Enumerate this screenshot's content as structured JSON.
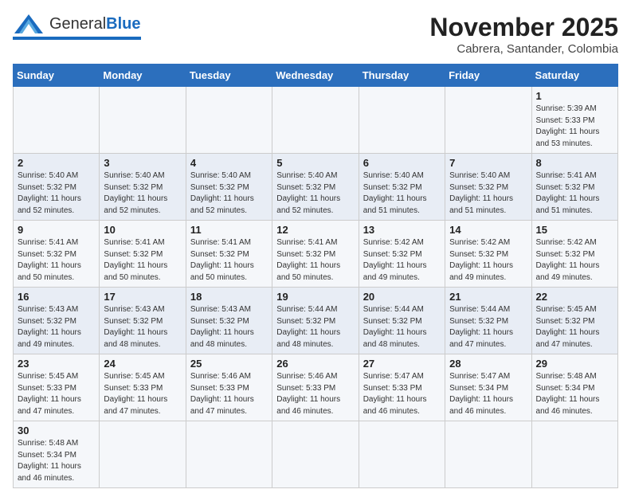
{
  "logo": {
    "text_general": "General",
    "text_blue": "Blue"
  },
  "header": {
    "month_year": "November 2025",
    "location": "Cabrera, Santander, Colombia"
  },
  "weekdays": [
    "Sunday",
    "Monday",
    "Tuesday",
    "Wednesday",
    "Thursday",
    "Friday",
    "Saturday"
  ],
  "weeks": [
    [
      {
        "day": "",
        "info": ""
      },
      {
        "day": "",
        "info": ""
      },
      {
        "day": "",
        "info": ""
      },
      {
        "day": "",
        "info": ""
      },
      {
        "day": "",
        "info": ""
      },
      {
        "day": "",
        "info": ""
      },
      {
        "day": "1",
        "info": "Sunrise: 5:39 AM\nSunset: 5:33 PM\nDaylight: 11 hours\nand 53 minutes."
      }
    ],
    [
      {
        "day": "2",
        "info": "Sunrise: 5:40 AM\nSunset: 5:32 PM\nDaylight: 11 hours\nand 52 minutes."
      },
      {
        "day": "3",
        "info": "Sunrise: 5:40 AM\nSunset: 5:32 PM\nDaylight: 11 hours\nand 52 minutes."
      },
      {
        "day": "4",
        "info": "Sunrise: 5:40 AM\nSunset: 5:32 PM\nDaylight: 11 hours\nand 52 minutes."
      },
      {
        "day": "5",
        "info": "Sunrise: 5:40 AM\nSunset: 5:32 PM\nDaylight: 11 hours\nand 52 minutes."
      },
      {
        "day": "6",
        "info": "Sunrise: 5:40 AM\nSunset: 5:32 PM\nDaylight: 11 hours\nand 51 minutes."
      },
      {
        "day": "7",
        "info": "Sunrise: 5:40 AM\nSunset: 5:32 PM\nDaylight: 11 hours\nand 51 minutes."
      },
      {
        "day": "8",
        "info": "Sunrise: 5:41 AM\nSunset: 5:32 PM\nDaylight: 11 hours\nand 51 minutes."
      }
    ],
    [
      {
        "day": "9",
        "info": "Sunrise: 5:41 AM\nSunset: 5:32 PM\nDaylight: 11 hours\nand 50 minutes."
      },
      {
        "day": "10",
        "info": "Sunrise: 5:41 AM\nSunset: 5:32 PM\nDaylight: 11 hours\nand 50 minutes."
      },
      {
        "day": "11",
        "info": "Sunrise: 5:41 AM\nSunset: 5:32 PM\nDaylight: 11 hours\nand 50 minutes."
      },
      {
        "day": "12",
        "info": "Sunrise: 5:41 AM\nSunset: 5:32 PM\nDaylight: 11 hours\nand 50 minutes."
      },
      {
        "day": "13",
        "info": "Sunrise: 5:42 AM\nSunset: 5:32 PM\nDaylight: 11 hours\nand 49 minutes."
      },
      {
        "day": "14",
        "info": "Sunrise: 5:42 AM\nSunset: 5:32 PM\nDaylight: 11 hours\nand 49 minutes."
      },
      {
        "day": "15",
        "info": "Sunrise: 5:42 AM\nSunset: 5:32 PM\nDaylight: 11 hours\nand 49 minutes."
      }
    ],
    [
      {
        "day": "16",
        "info": "Sunrise: 5:43 AM\nSunset: 5:32 PM\nDaylight: 11 hours\nand 49 minutes."
      },
      {
        "day": "17",
        "info": "Sunrise: 5:43 AM\nSunset: 5:32 PM\nDaylight: 11 hours\nand 48 minutes."
      },
      {
        "day": "18",
        "info": "Sunrise: 5:43 AM\nSunset: 5:32 PM\nDaylight: 11 hours\nand 48 minutes."
      },
      {
        "day": "19",
        "info": "Sunrise: 5:44 AM\nSunset: 5:32 PM\nDaylight: 11 hours\nand 48 minutes."
      },
      {
        "day": "20",
        "info": "Sunrise: 5:44 AM\nSunset: 5:32 PM\nDaylight: 11 hours\nand 48 minutes."
      },
      {
        "day": "21",
        "info": "Sunrise: 5:44 AM\nSunset: 5:32 PM\nDaylight: 11 hours\nand 47 minutes."
      },
      {
        "day": "22",
        "info": "Sunrise: 5:45 AM\nSunset: 5:32 PM\nDaylight: 11 hours\nand 47 minutes."
      }
    ],
    [
      {
        "day": "23",
        "info": "Sunrise: 5:45 AM\nSunset: 5:33 PM\nDaylight: 11 hours\nand 47 minutes."
      },
      {
        "day": "24",
        "info": "Sunrise: 5:45 AM\nSunset: 5:33 PM\nDaylight: 11 hours\nand 47 minutes."
      },
      {
        "day": "25",
        "info": "Sunrise: 5:46 AM\nSunset: 5:33 PM\nDaylight: 11 hours\nand 47 minutes."
      },
      {
        "day": "26",
        "info": "Sunrise: 5:46 AM\nSunset: 5:33 PM\nDaylight: 11 hours\nand 46 minutes."
      },
      {
        "day": "27",
        "info": "Sunrise: 5:47 AM\nSunset: 5:33 PM\nDaylight: 11 hours\nand 46 minutes."
      },
      {
        "day": "28",
        "info": "Sunrise: 5:47 AM\nSunset: 5:34 PM\nDaylight: 11 hours\nand 46 minutes."
      },
      {
        "day": "29",
        "info": "Sunrise: 5:48 AM\nSunset: 5:34 PM\nDaylight: 11 hours\nand 46 minutes."
      }
    ],
    [
      {
        "day": "30",
        "info": "Sunrise: 5:48 AM\nSunset: 5:34 PM\nDaylight: 11 hours\nand 46 minutes."
      },
      {
        "day": "",
        "info": ""
      },
      {
        "day": "",
        "info": ""
      },
      {
        "day": "",
        "info": ""
      },
      {
        "day": "",
        "info": ""
      },
      {
        "day": "",
        "info": ""
      },
      {
        "day": "",
        "info": ""
      }
    ]
  ]
}
